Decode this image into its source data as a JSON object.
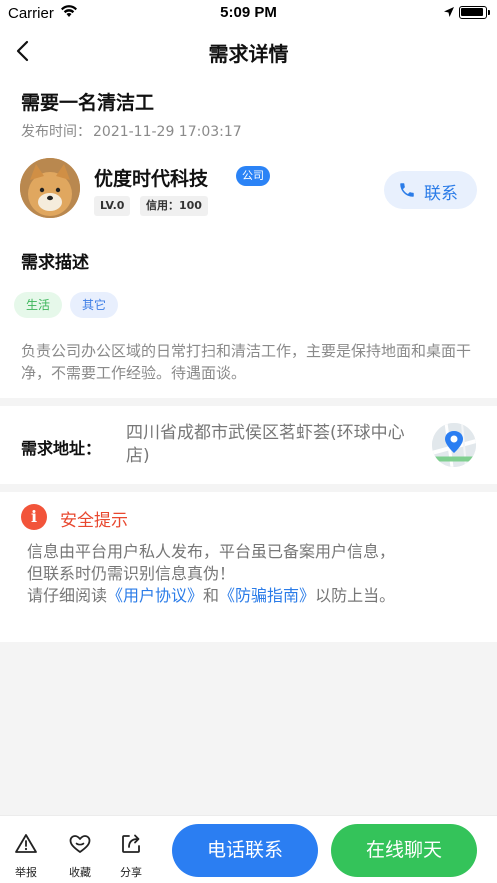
{
  "status_bar": {
    "carrier": "Carrier",
    "time": "5:09 PM"
  },
  "nav": {
    "title": "需求详情"
  },
  "post": {
    "title": "需要一名清洁工",
    "time_label": "发布时间：",
    "time_value": "2021-11-29 17:03:17"
  },
  "publisher": {
    "name": "优度时代科技",
    "badge": "公司",
    "level": "LV.0",
    "credit": "信用：100",
    "contact_label": "联系"
  },
  "description": {
    "heading": "需求描述",
    "tags": [
      "生活",
      "其它"
    ],
    "text": "负责公司办公区域的日常打扫和清洁工作，主要是保持地面和桌面干净，不需要工作经验。待遇面谈。"
  },
  "address": {
    "label": "需求地址：",
    "value": "四川省成都市武侯区茗虾荟(环球中心店)"
  },
  "safety": {
    "title": "安全提示",
    "line1": "信息由平台用户私人发布，平台虽已备案用户信息，",
    "line2": "但联系时仍需识别信息真伪！",
    "line3_prefix": "请仔细阅读",
    "link_agreement": "《用户协议》",
    "line3_and": "和",
    "link_guide": "《防骗指南》",
    "line3_suffix": "以防上当。"
  },
  "bottom_bar": {
    "report_label": "举报",
    "favorite_label": "收藏",
    "share_label": "分享",
    "call_button": "电话联系",
    "chat_button": "在线聊天"
  },
  "colors": {
    "primary_blue": "#2b7ef2",
    "chat_green": "#34c35a",
    "warning_red": "#f2543a",
    "tag_life_green": "#3cb55a",
    "tag_other_blue": "#3d7ee6"
  }
}
